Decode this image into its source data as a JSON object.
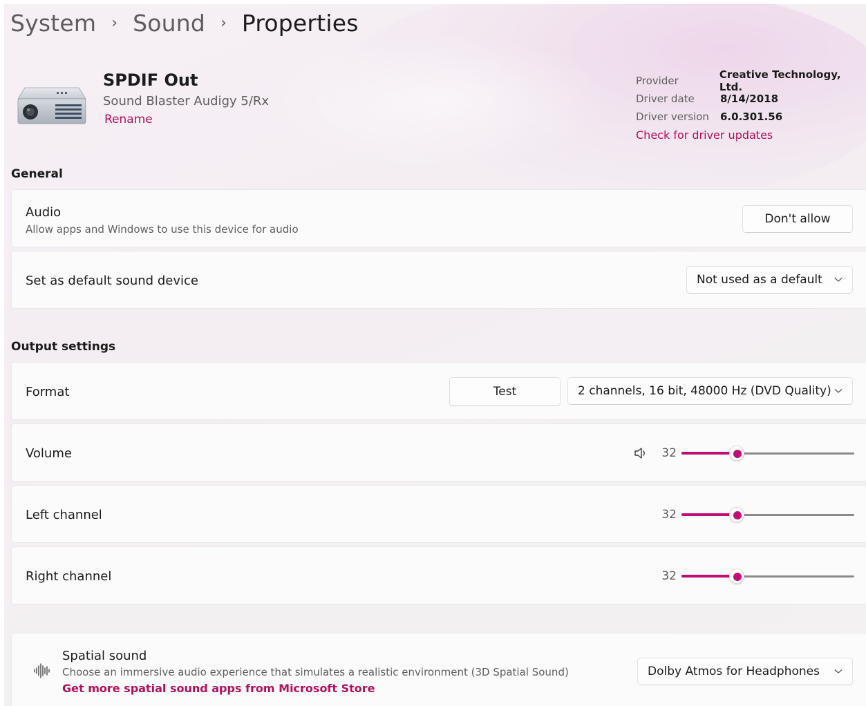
{
  "breadcrumb": {
    "items": [
      "System",
      "Sound",
      "Properties"
    ],
    "separator": "›"
  },
  "device": {
    "name": "SPDIF Out",
    "model": "Sound Blaster Audigy 5/Rx",
    "rename_label": "Rename",
    "icon": "sound-card-icon"
  },
  "driver": {
    "provider_label": "Provider",
    "provider_value": "Creative Technology, Ltd.",
    "date_label": "Driver date",
    "date_value": "8/14/2018",
    "version_label": "Driver version",
    "version_value": "6.0.301.56",
    "update_link": "Check for driver updates"
  },
  "general": {
    "title": "General",
    "audio": {
      "title": "Audio",
      "subtitle": "Allow apps and Windows to use this device for audio",
      "button_label": "Don't allow"
    },
    "default_device": {
      "title": "Set as default sound device",
      "selected": "Not used as a default"
    }
  },
  "output": {
    "title": "Output settings",
    "format": {
      "title": "Format",
      "test_label": "Test",
      "selected": "2 channels, 16 bit, 48000 Hz (DVD Quality)"
    },
    "volume": {
      "title": "Volume",
      "value": 32,
      "icon": "speaker-icon"
    },
    "left_channel": {
      "title": "Left channel",
      "value": 32
    },
    "right_channel": {
      "title": "Right channel",
      "value": 32
    }
  },
  "spatial": {
    "title": "Spatial sound",
    "subtitle": "Choose an immersive audio experience that simulates a realistic environment (3D Spatial Sound)",
    "store_link": "Get more spatial sound apps from Microsoft Store",
    "selected": "Dolby Atmos for Headphones",
    "icon": "spatial-audio-icon"
  },
  "colors": {
    "accent": "#c30c75",
    "link": "#b1105f"
  }
}
